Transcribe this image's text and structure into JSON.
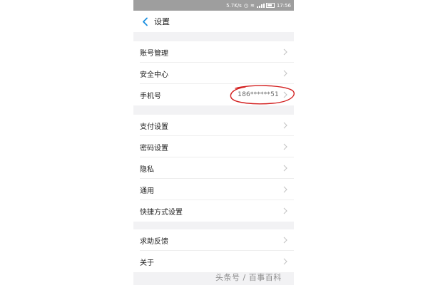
{
  "status_bar": {
    "speed": "5.7K/s",
    "time": "17:56"
  },
  "header": {
    "back_icon": "chevron-left-icon",
    "title": "设置"
  },
  "groups": [
    {
      "items": [
        {
          "label": "账号管理",
          "value": ""
        },
        {
          "label": "安全中心",
          "value": ""
        },
        {
          "label": "手机号",
          "value": "186******51"
        }
      ]
    },
    {
      "items": [
        {
          "label": "支付设置",
          "value": ""
        },
        {
          "label": "密码设置",
          "value": ""
        },
        {
          "label": "隐私",
          "value": ""
        },
        {
          "label": "通用",
          "value": ""
        },
        {
          "label": "快捷方式设置",
          "value": ""
        }
      ]
    },
    {
      "items": [
        {
          "label": "求助反馈",
          "value": ""
        },
        {
          "label": "关于",
          "value": ""
        }
      ]
    }
  ],
  "watermark": "头条号 / 百事百科",
  "colors": {
    "accent": "#1a8fe0",
    "status_bar": "#9e9e9e",
    "separator": "#f2f2f4",
    "annotation": "#d32020"
  }
}
